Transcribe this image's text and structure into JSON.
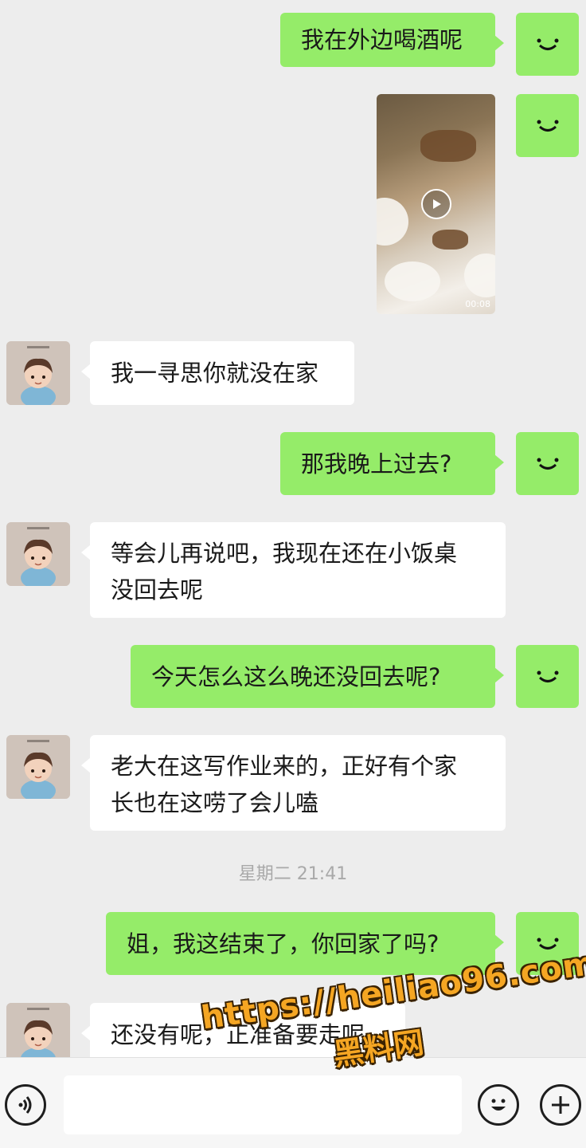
{
  "messages": [
    {
      "side": "right",
      "text": "我在外边喝酒呢"
    },
    {
      "side": "right",
      "type": "video"
    },
    {
      "side": "left",
      "text": "我一寻思你就没在家"
    },
    {
      "side": "right",
      "text": "那我晚上过去?"
    },
    {
      "side": "left",
      "text_lines": [
        "等会儿再说吧，我现在还在小饭桌",
        "没回去呢"
      ]
    },
    {
      "side": "right",
      "text": "今天怎么这么晚还没回去呢?"
    },
    {
      "side": "left",
      "text_lines": [
        "老大在这写作业来的，正好有个家",
        "长也在这唠了会儿嗑"
      ]
    },
    {
      "side": "right",
      "text": "姐，我这结束了，你回家了吗?"
    },
    {
      "side": "left",
      "text": "还没有呢，正准备要走呢"
    }
  ],
  "timestamp": "星期二 21:41",
  "input_bar": {
    "voice_icon": "voice-icon",
    "emoji_icon": "emoji-icon",
    "plus_icon": "plus-icon"
  },
  "watermark": {
    "url": "https://heiliao96.com",
    "name": "黑料网"
  },
  "colors": {
    "background": "#ededed",
    "self_bubble": "#95ec69",
    "other_bubble": "#ffffff",
    "watermark": "#f5a623"
  }
}
